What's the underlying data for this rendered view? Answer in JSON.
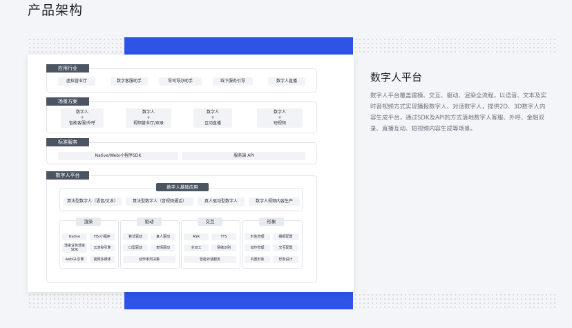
{
  "page_title": "产品架构",
  "right_panel": {
    "title": "数字人平台",
    "description": "数字人平台覆盖建模、交互、驱动、渲染全流程，以语音、文本及实时音视频方式实现播报数字人、对话数字人，提供2D、3D数字人内容生成平台，通过SDK及API的方式落地数字人客服、外呼、金融双录、直播互动、短视频内容生成等场景。"
  },
  "diagram": {
    "industry": {
      "label": "应用行业",
      "items": [
        "虚拟营业厅",
        "数字客服助手",
        "导司导办助手",
        "线下服务引导",
        "数字人直播"
      ]
    },
    "scenario": {
      "label": "场景方案",
      "items": [
        "数字人\n+\n智能客服/外呼",
        "数字人\n+\n视频营业厅/双录",
        "数字人\n+\n互动直播",
        "数字人\n+\n短视频"
      ]
    },
    "standard": {
      "label": "标准服务",
      "items": [
        "Native/Web/小程序SDK",
        "服务端 API"
      ]
    },
    "platform": {
      "label": "数字人平台",
      "basic_title": "数字人基础应用",
      "basic_items": [
        "算法型数字人（语音/文本）",
        "算法型数字人（音视频通话）",
        "真人驱动型数字人",
        "数字人视频内容生产"
      ],
      "columns": [
        {
          "title": "渲染",
          "items": [
            "Native",
            "H5/小程序",
            "渲染业务渲染 SDK",
            "云渲染引擎",
            "webGL引擎",
            "视频多媒体"
          ]
        },
        {
          "title": "驱动",
          "items": [
            "算法驱动",
            "真人驱动",
            "口型驱动",
            "表情驱动",
            "动作序列决策"
          ]
        },
        {
          "title": "交互",
          "items": [
            "ASR",
            "TTS",
            "全双工",
            "情绪识别",
            "智能对话服务"
          ]
        },
        {
          "title": "形象",
          "items": [
            "形象管理",
            "播报配置",
            "动作管理",
            "交互配置",
            "内置形象",
            "形象设计"
          ]
        }
      ]
    }
  }
}
